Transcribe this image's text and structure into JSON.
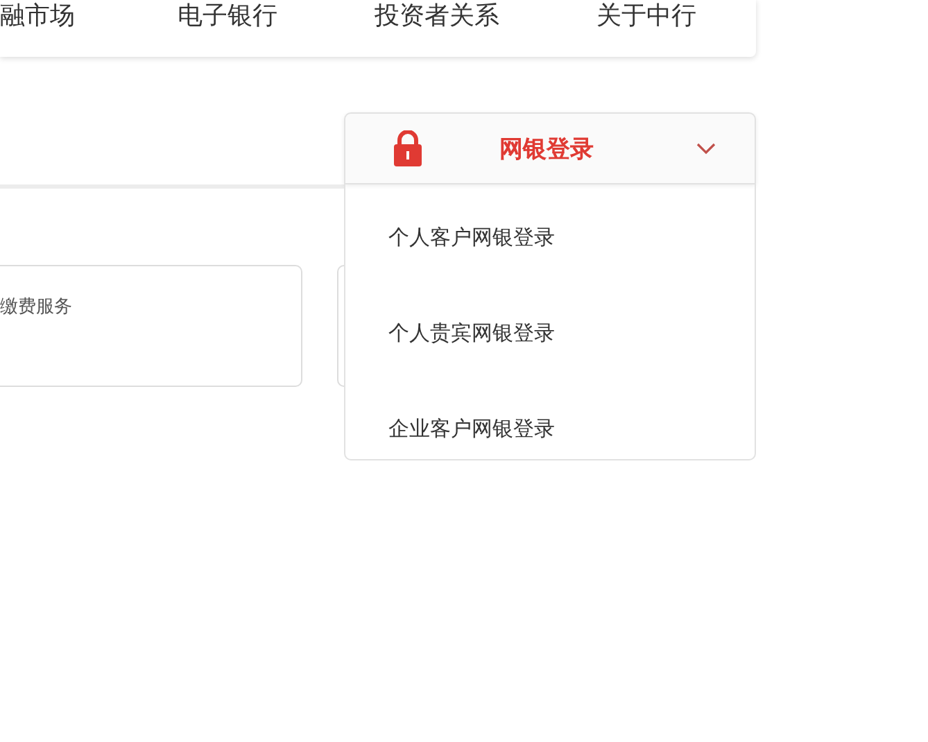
{
  "nav": {
    "items": [
      "融市场",
      "电子银行",
      "投资者关系",
      "关于中行"
    ]
  },
  "service_card": {
    "label": "缴费服务"
  },
  "login_dropdown": {
    "title": "网银登录",
    "expanded": true,
    "items": [
      "个人客户网银登录",
      "个人贵宾网银登录",
      "企业客户网银登录"
    ]
  }
}
